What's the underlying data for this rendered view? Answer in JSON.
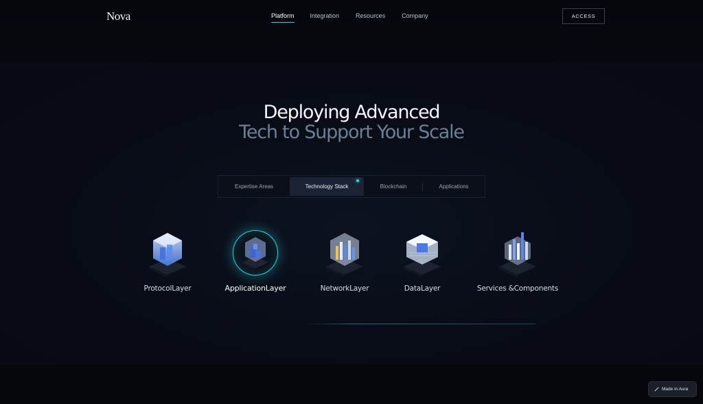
{
  "brand": {
    "logo": "Nova"
  },
  "nav": {
    "items": [
      {
        "label": "Platform",
        "active": true
      },
      {
        "label": "Integration",
        "active": false
      },
      {
        "label": "Resources",
        "active": false
      },
      {
        "label": "Company",
        "active": false
      }
    ],
    "access_label": "ACCESS"
  },
  "hero": {
    "line1": "Deploying Advanced",
    "line2": "Tech to Support Your Scale"
  },
  "tabs": [
    {
      "label": "Expertise Areas",
      "active": false
    },
    {
      "label": "Technology Stack",
      "active": true
    },
    {
      "label": "Blockchain",
      "active": false
    },
    {
      "label": "Applications",
      "active": false
    }
  ],
  "layers": [
    {
      "label": "ProtocolLayer",
      "icon": "protocol-layer-icon",
      "active": false
    },
    {
      "label": "ApplicationLayer",
      "icon": "application-layer-icon",
      "active": true
    },
    {
      "label": "NetworkLayer",
      "icon": "network-layer-icon",
      "active": false
    },
    {
      "label": "DataLayer",
      "icon": "data-layer-icon",
      "active": false
    },
    {
      "label": "Services &Components",
      "icon": "services-components-icon",
      "active": false
    }
  ],
  "badge": {
    "label": "Made in Aura"
  },
  "colors": {
    "accent": "#2fd6e0",
    "background": "#070a12",
    "muted_headline": "#6c7f96"
  }
}
